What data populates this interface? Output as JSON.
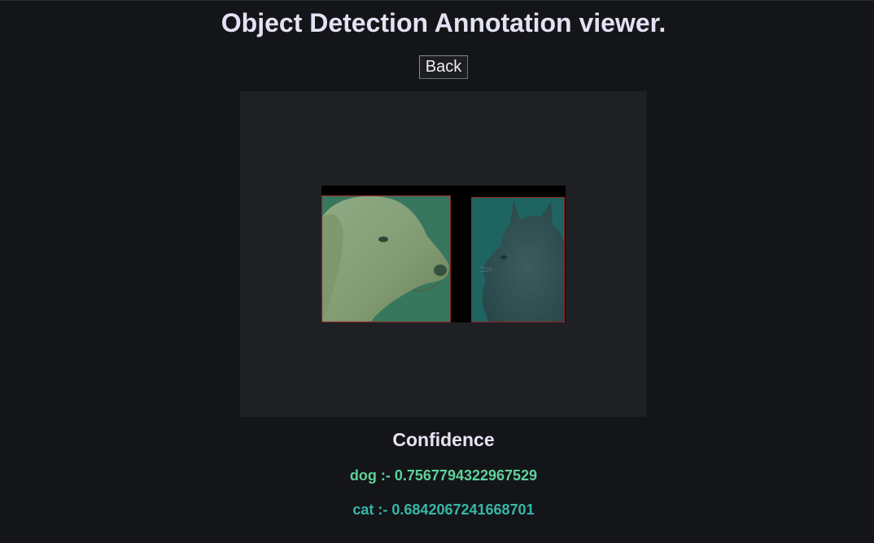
{
  "page": {
    "title": "Object Detection Annotation viewer.",
    "back_label": "Back"
  },
  "viewer": {
    "image_description_icon": "dog-and-cat-photo-icon"
  },
  "detections": [
    {
      "label": "dog",
      "confidence": 0.7567794322967529,
      "color": "#5fd19a"
    },
    {
      "label": "cat",
      "confidence": 0.6842067241668701,
      "color": "#36b7a8"
    }
  ],
  "confidence": {
    "heading": "Confidence",
    "dog_text": "dog :- 0.7567794322967529",
    "cat_text": "cat :- 0.6842067241668701"
  },
  "colors": {
    "background": "#141518",
    "canvas": "#1f2024",
    "box_outline": "#8b2a2a",
    "dog_overlay": "#2f8f6a",
    "cat_overlay": "#1f7f7a"
  }
}
